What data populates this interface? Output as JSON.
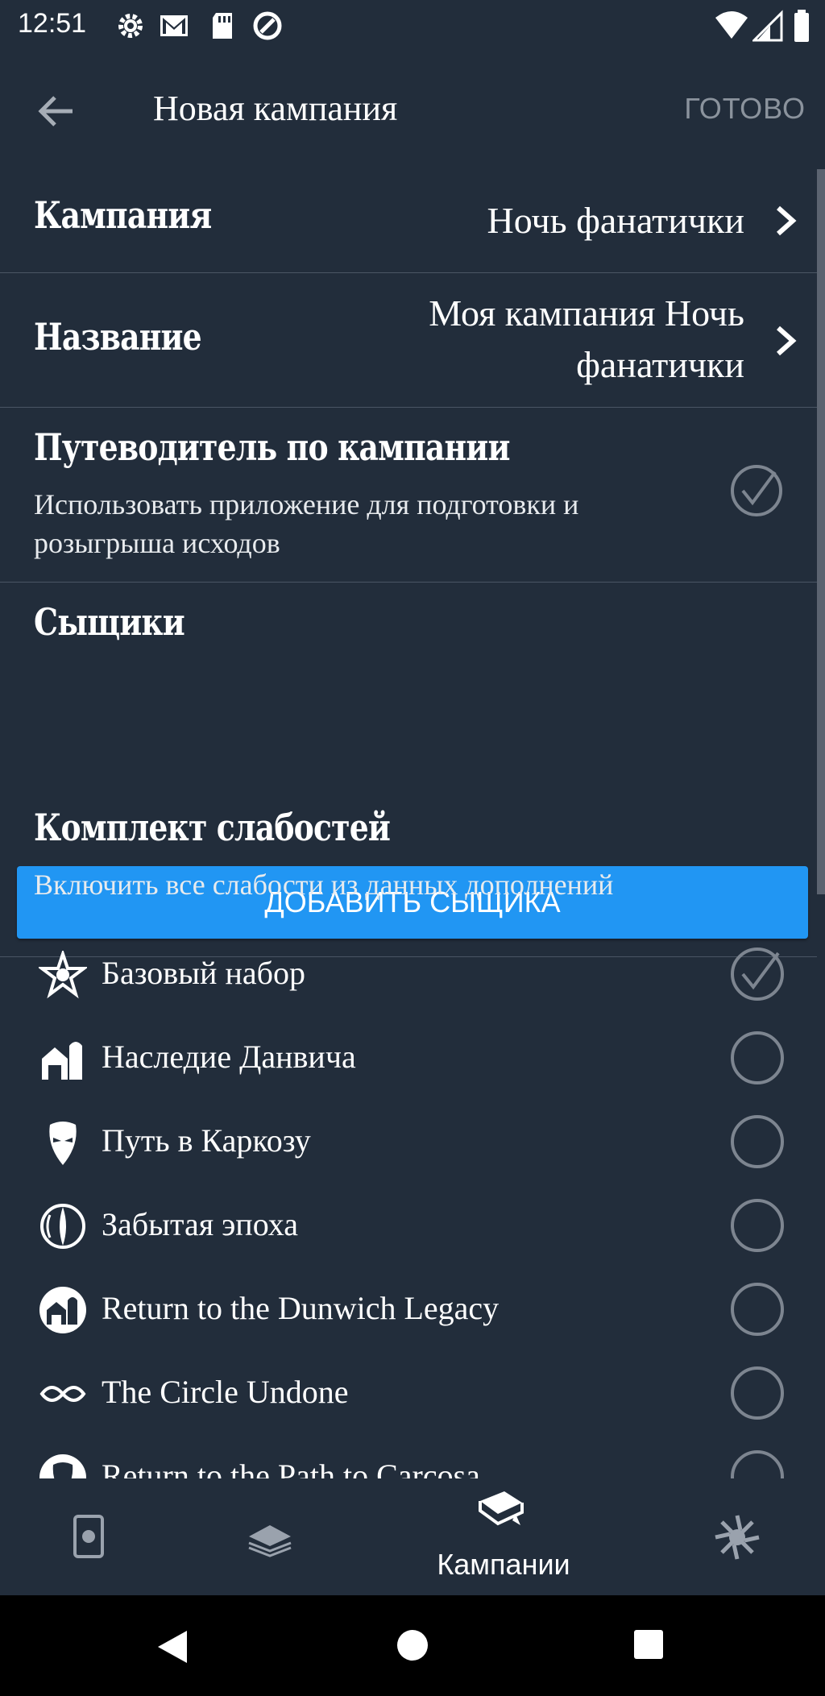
{
  "status_bar": {
    "time": "12:51"
  },
  "app_bar": {
    "title": "Новая кампания",
    "done": "ГОТОВО"
  },
  "campaign_row": {
    "label": "Кампания",
    "value": "Ночь фанатички"
  },
  "name_row": {
    "label": "Название",
    "value_line1": "Моя кампания Ночь",
    "value_line2": "фанатички"
  },
  "guide_row": {
    "label": "Путеводитель по кампании",
    "desc_line1": "Использовать приложение для подготовки и",
    "desc_line2": "розыгрыша исходов",
    "checked": true
  },
  "investigators": {
    "label": "Сыщики",
    "add_button": "ДОБАВИТЬ СЫЩИКА"
  },
  "weakness": {
    "label": "Комплект слабостей",
    "desc": "Включить все слабости из данных дополнений",
    "items": [
      {
        "label": "Базовый набор",
        "icon": "core-set-icon",
        "checked": true
      },
      {
        "label": "Наследие Данвича",
        "icon": "dunwich-icon",
        "checked": false
      },
      {
        "label": "Путь в Каркозу",
        "icon": "carcosa-mask-icon",
        "checked": false
      },
      {
        "label": "Забытая эпоха",
        "icon": "forgotten-age-icon",
        "checked": false
      },
      {
        "label": "Return to the Dunwich Legacy",
        "icon": "return-dunwich-icon",
        "checked": false
      },
      {
        "label": "The Circle Undone",
        "icon": "circle-undone-icon",
        "checked": false
      },
      {
        "label": "Return to the Path to Carcosa",
        "icon": "return-carcosa-icon",
        "checked": false
      }
    ]
  },
  "bottom_nav": {
    "active_label": "Кампании"
  },
  "colors": {
    "background": "#222d3b",
    "accent": "#2196f3",
    "divider": "#4a5564",
    "muted": "#8b939d"
  }
}
